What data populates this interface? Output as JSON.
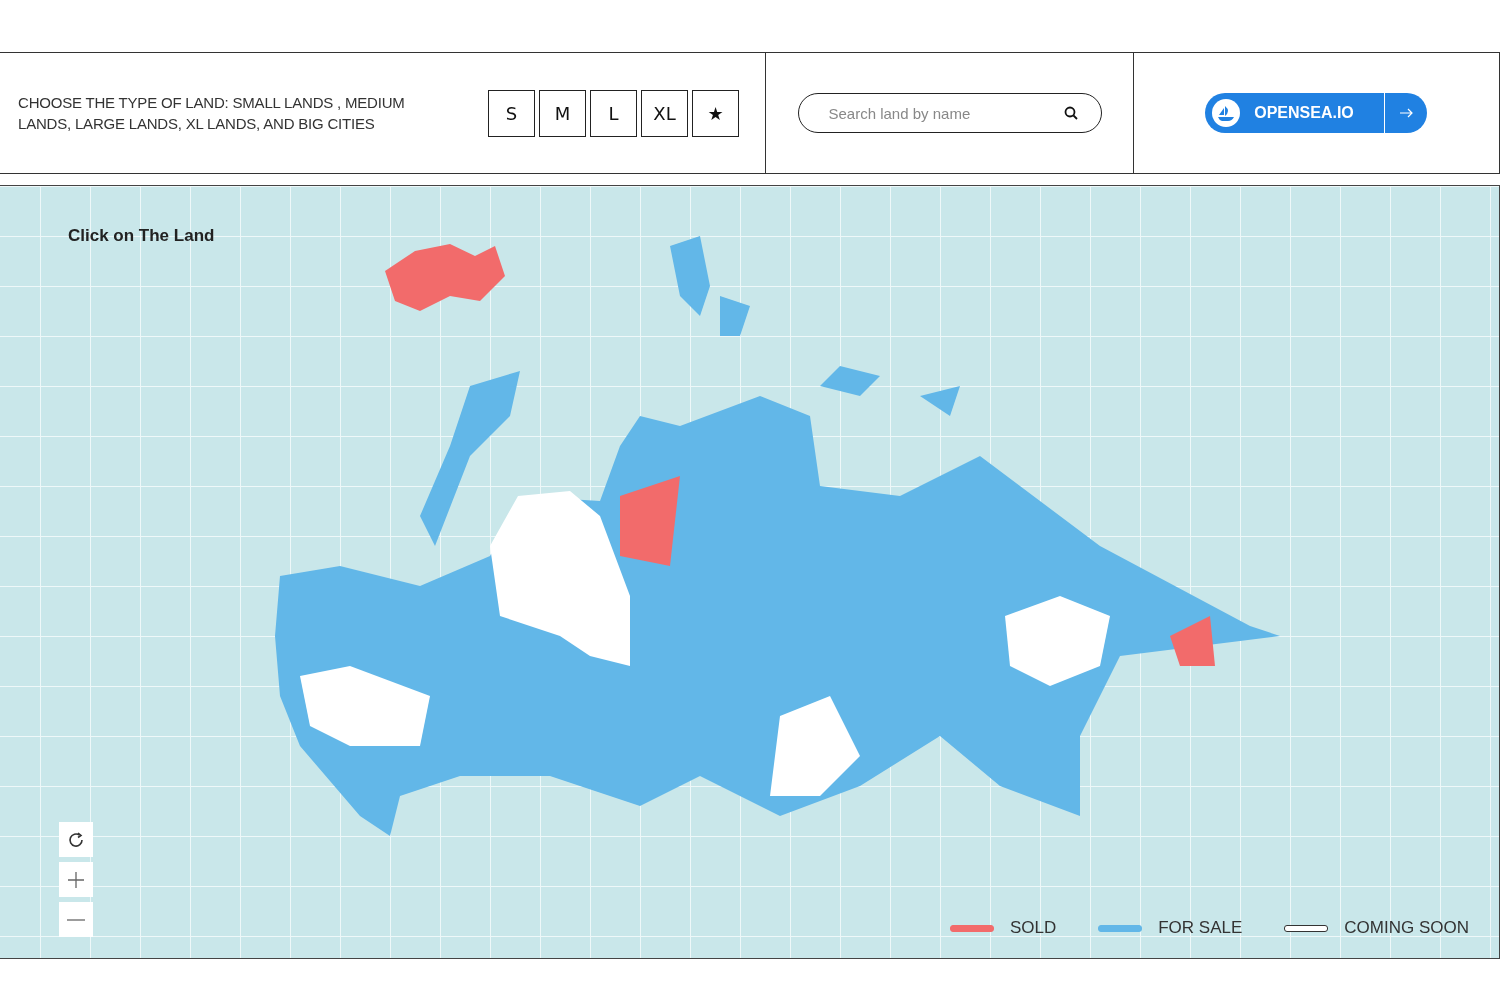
{
  "header": {
    "prompt": "CHOOSE THE TYPE OF LAND: SMALL LANDS , MEDIUM LANDS, LARGE LANDS, XL LANDS, AND BIG CITIES",
    "size_buttons": [
      "S",
      "M",
      "L",
      "XL",
      "★"
    ],
    "search": {
      "placeholder": "Search land by name"
    },
    "opensea_button": {
      "label": "OPENSEA.IO"
    }
  },
  "map": {
    "title": "Click on The Land",
    "legend": [
      {
        "label": "SOLD",
        "color": "#f26b6b"
      },
      {
        "label": "FOR SALE",
        "color": "#62b7e8"
      },
      {
        "label": "COMING SOON",
        "color": "#ffffff"
      }
    ]
  }
}
